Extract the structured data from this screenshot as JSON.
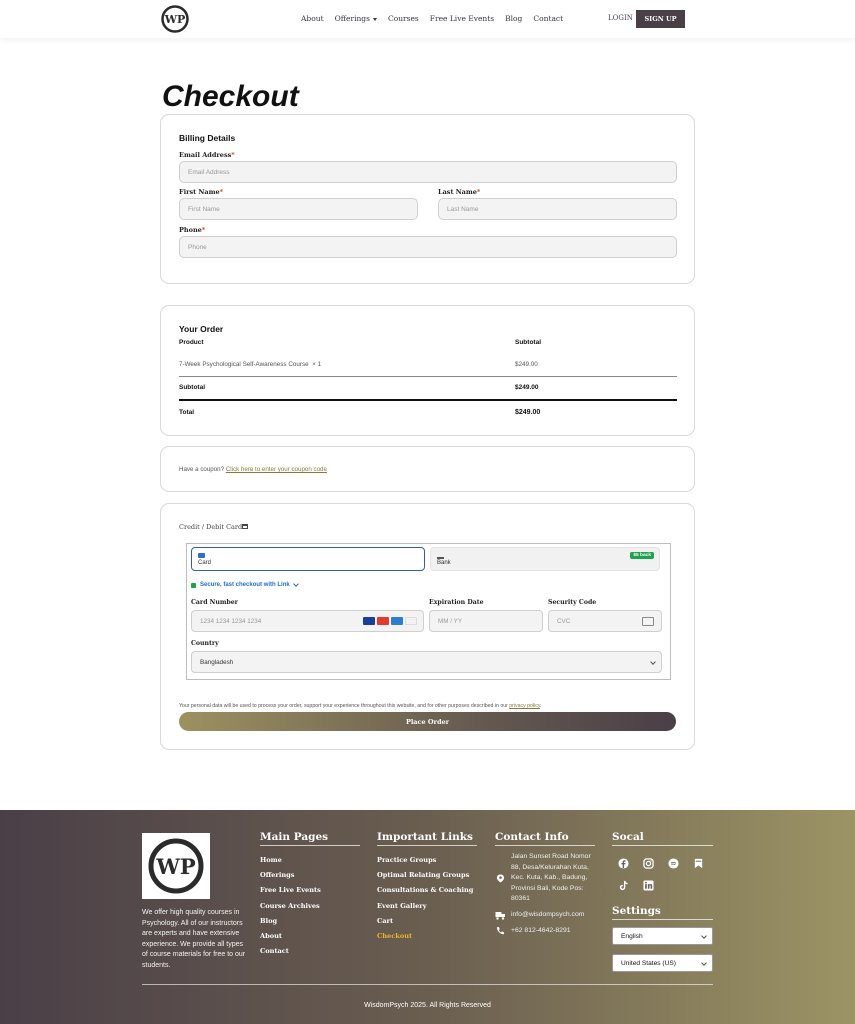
{
  "header": {
    "logo_text": "WP",
    "nav": [
      "About",
      "Offerings",
      "Courses",
      "Free Live Events",
      "Blog",
      "Contact"
    ],
    "login": "LOGIN",
    "signup": "SIGN UP"
  },
  "page_title": "Checkout",
  "billing": {
    "title": "Billing Details",
    "email_label": "Email Address",
    "email_placeholder": "Email Address",
    "first_label": "First Name",
    "first_placeholder": "First Name",
    "last_label": "Last Name",
    "last_placeholder": "Last Name",
    "phone_label": "Phone",
    "phone_placeholder": "Phone",
    "required_mark": "*"
  },
  "order": {
    "title": "Your Order",
    "col_product": "Product",
    "col_subtotal": "Subtotal",
    "item_name": "7-Week Psychological Self-Awareness Course",
    "item_qty": "× 1",
    "item_price": "$249.00",
    "subtotal_label": "Subtotal",
    "subtotal_value": "$249.00",
    "total_label": "Total",
    "total_value": "$249.00"
  },
  "coupon": {
    "text": "Have a coupon?",
    "link": "Click here to enter your coupon code"
  },
  "payment": {
    "method_title": "Credit / Debit Card",
    "tab_card": "Card",
    "tab_bank": "Bank",
    "bank_badge": "$5 back",
    "link_text": "Secure, fast checkout with Link",
    "card_number_label": "Card Number",
    "card_number_placeholder": "1234 1234 1234 1234",
    "expiry_label": "Expiration Date",
    "expiry_placeholder": "MM / YY",
    "cvc_label": "Security Code",
    "cvc_placeholder": "CVC",
    "country_label": "Country",
    "country_value": "Bangladesh",
    "privacy_text": "Your personal data will be used to process your order, support your experience throughout this website, and for other purposes described in our",
    "privacy_link": "privacy policy",
    "place_order": "Place Order"
  },
  "footer": {
    "logo_text": "WP",
    "description": "We offer high quality courses in Psychology. All of our instructors are experts and have extensive experience. We provide all types of course materials for free to our students.",
    "main_pages_title": "Main Pages",
    "main_pages": [
      "Home",
      "Offerings",
      "Free Live Events",
      "Course Archives",
      "Blog",
      "About",
      "Contact"
    ],
    "important_title": "Important Links",
    "important_links": [
      "Practice Groups",
      "Optimal Relating Groups",
      "Consultations & Coaching",
      "Event Gallery",
      "Cart",
      "Checkout"
    ],
    "contact_title": "Contact Info",
    "address": "Jalan Sunset Road Nomor 88, Desa/Kelurahan Kuta, Kec. Kuta, Kab., Badung, Provinsi Bali, Kode Pos: 80361",
    "email": "info@wisdompsych.com",
    "phone": "+62 812-4642-8291",
    "social_title": "Socal",
    "settings_title": "Settings",
    "language": "English",
    "region": "United States (US)",
    "copyright": "WisdomPsych 2025. All Rights Reserved"
  }
}
